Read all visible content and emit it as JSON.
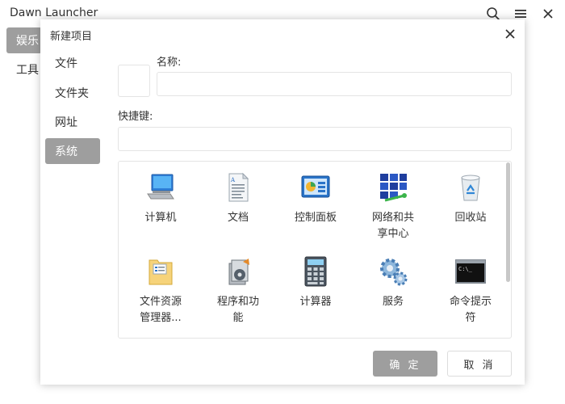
{
  "app": {
    "title": "Dawn Launcher",
    "icons": [
      "search-icon",
      "menu-icon",
      "close-icon"
    ],
    "categories": [
      {
        "label": "娱乐",
        "active": true
      },
      {
        "label": "工具",
        "active": false
      }
    ]
  },
  "dialog": {
    "title": "新建项目",
    "types": [
      {
        "label": "文件",
        "active": false
      },
      {
        "label": "文件夹",
        "active": false
      },
      {
        "label": "网址",
        "active": false
      },
      {
        "label": "系统",
        "active": true
      }
    ],
    "name_label": "名称:",
    "name_value": "",
    "hotkey_label": "快捷键:",
    "hotkey_value": "",
    "system_items": [
      {
        "label": "计算机",
        "icon": "computer-icon"
      },
      {
        "label": "文档",
        "icon": "document-icon"
      },
      {
        "label": "控制面板",
        "icon": "control-panel-icon"
      },
      {
        "label": "网络和共享中心",
        "icon": "network-icon"
      },
      {
        "label": "回收站",
        "icon": "recycle-bin-icon"
      },
      {
        "label": "文件资源管理器...",
        "icon": "file-explorer-icon"
      },
      {
        "label": "程序和功能",
        "icon": "programs-icon"
      },
      {
        "label": "计算器",
        "icon": "calculator-icon"
      },
      {
        "label": "服务",
        "icon": "services-icon"
      },
      {
        "label": "命令提示符",
        "icon": "command-prompt-icon"
      }
    ],
    "ok_label": "确 定",
    "cancel_label": "取 消"
  }
}
